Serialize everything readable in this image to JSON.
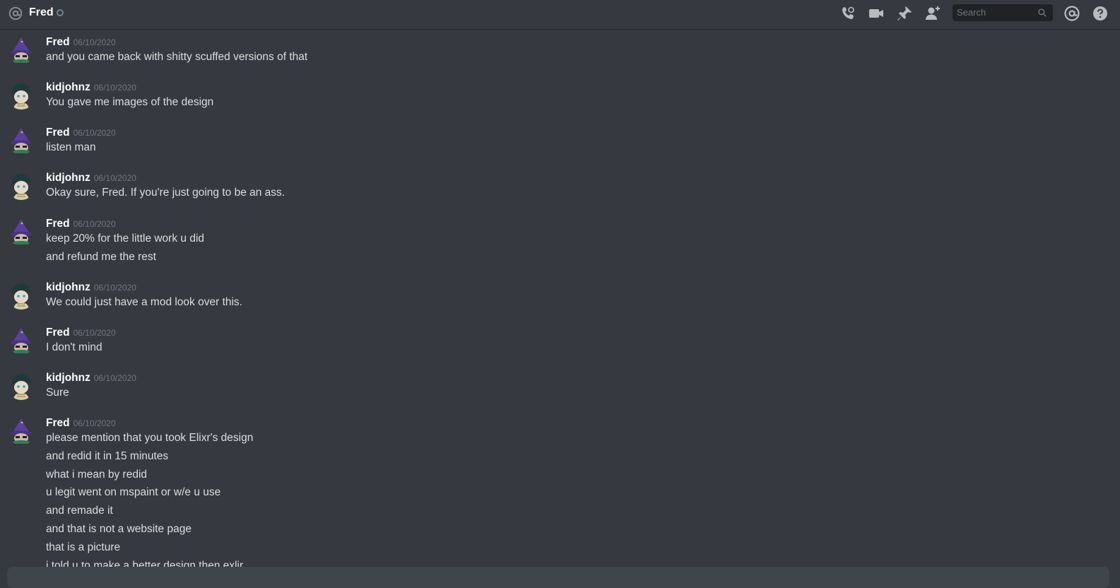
{
  "header": {
    "channel_name": "Fred",
    "search_placeholder": "Search",
    "icons": [
      "at-icon",
      "status-dot",
      "call-icon",
      "video-icon",
      "pin-icon",
      "add-friend-icon",
      "search-icon",
      "mentions-icon",
      "help-icon"
    ]
  },
  "colors": {
    "background": "#36393f",
    "author": "#ffffff",
    "text": "#dcddde",
    "timestamp": "#72767d",
    "search_bg": "#202225"
  },
  "messages": [
    {
      "author": "Fred",
      "timestamp": "06/10/2020",
      "lines": [
        "and you came back with shitty scuffed versions of that"
      ]
    },
    {
      "author": "kidjohnz",
      "timestamp": "06/10/2020",
      "lines": [
        "You gave me images of the design"
      ]
    },
    {
      "author": "Fred",
      "timestamp": "06/10/2020",
      "lines": [
        "listen man"
      ]
    },
    {
      "author": "kidjohnz",
      "timestamp": "06/10/2020",
      "lines": [
        "Okay sure, Fred. If you're just going to be an ass."
      ]
    },
    {
      "author": "Fred",
      "timestamp": "06/10/2020",
      "lines": [
        "keep 20% for the little work u did",
        "and refund me the rest"
      ]
    },
    {
      "author": "kidjohnz",
      "timestamp": "06/10/2020",
      "lines": [
        "We could just have a mod look over this."
      ]
    },
    {
      "author": "Fred",
      "timestamp": "06/10/2020",
      "lines": [
        "I don't mind"
      ]
    },
    {
      "author": "kidjohnz",
      "timestamp": "06/10/2020",
      "lines": [
        "Sure"
      ]
    },
    {
      "author": "Fred",
      "timestamp": "06/10/2020",
      "lines": [
        "please mention that you took Elixr's design",
        "and redid it in 15 minutes",
        "what i mean by redid",
        "u legit went on mspaint or w/e u use",
        "and remade it",
        "and that is not a website page",
        "that is a picture",
        "i told u to make a better design then exlir"
      ]
    }
  ]
}
